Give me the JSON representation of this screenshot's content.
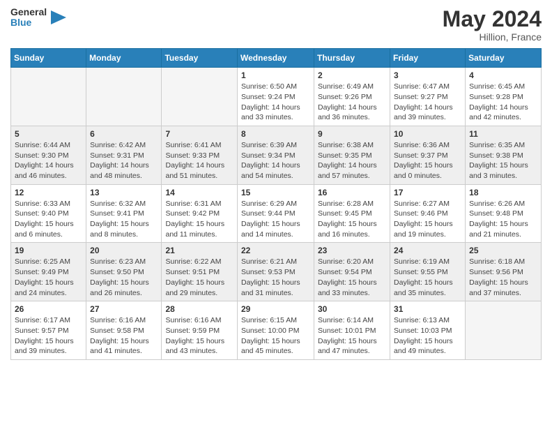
{
  "header": {
    "logo_general": "General",
    "logo_blue": "Blue",
    "month_year": "May 2024",
    "location": "Hillion, France"
  },
  "days_of_week": [
    "Sunday",
    "Monday",
    "Tuesday",
    "Wednesday",
    "Thursday",
    "Friday",
    "Saturday"
  ],
  "weeks": [
    [
      {
        "day": "",
        "info": ""
      },
      {
        "day": "",
        "info": ""
      },
      {
        "day": "",
        "info": ""
      },
      {
        "day": "1",
        "info": "Sunrise: 6:50 AM\nSunset: 9:24 PM\nDaylight: 14 hours\nand 33 minutes."
      },
      {
        "day": "2",
        "info": "Sunrise: 6:49 AM\nSunset: 9:26 PM\nDaylight: 14 hours\nand 36 minutes."
      },
      {
        "day": "3",
        "info": "Sunrise: 6:47 AM\nSunset: 9:27 PM\nDaylight: 14 hours\nand 39 minutes."
      },
      {
        "day": "4",
        "info": "Sunrise: 6:45 AM\nSunset: 9:28 PM\nDaylight: 14 hours\nand 42 minutes."
      }
    ],
    [
      {
        "day": "5",
        "info": "Sunrise: 6:44 AM\nSunset: 9:30 PM\nDaylight: 14 hours\nand 46 minutes."
      },
      {
        "day": "6",
        "info": "Sunrise: 6:42 AM\nSunset: 9:31 PM\nDaylight: 14 hours\nand 48 minutes."
      },
      {
        "day": "7",
        "info": "Sunrise: 6:41 AM\nSunset: 9:33 PM\nDaylight: 14 hours\nand 51 minutes."
      },
      {
        "day": "8",
        "info": "Sunrise: 6:39 AM\nSunset: 9:34 PM\nDaylight: 14 hours\nand 54 minutes."
      },
      {
        "day": "9",
        "info": "Sunrise: 6:38 AM\nSunset: 9:35 PM\nDaylight: 14 hours\nand 57 minutes."
      },
      {
        "day": "10",
        "info": "Sunrise: 6:36 AM\nSunset: 9:37 PM\nDaylight: 15 hours\nand 0 minutes."
      },
      {
        "day": "11",
        "info": "Sunrise: 6:35 AM\nSunset: 9:38 PM\nDaylight: 15 hours\nand 3 minutes."
      }
    ],
    [
      {
        "day": "12",
        "info": "Sunrise: 6:33 AM\nSunset: 9:40 PM\nDaylight: 15 hours\nand 6 minutes."
      },
      {
        "day": "13",
        "info": "Sunrise: 6:32 AM\nSunset: 9:41 PM\nDaylight: 15 hours\nand 8 minutes."
      },
      {
        "day": "14",
        "info": "Sunrise: 6:31 AM\nSunset: 9:42 PM\nDaylight: 15 hours\nand 11 minutes."
      },
      {
        "day": "15",
        "info": "Sunrise: 6:29 AM\nSunset: 9:44 PM\nDaylight: 15 hours\nand 14 minutes."
      },
      {
        "day": "16",
        "info": "Sunrise: 6:28 AM\nSunset: 9:45 PM\nDaylight: 15 hours\nand 16 minutes."
      },
      {
        "day": "17",
        "info": "Sunrise: 6:27 AM\nSunset: 9:46 PM\nDaylight: 15 hours\nand 19 minutes."
      },
      {
        "day": "18",
        "info": "Sunrise: 6:26 AM\nSunset: 9:48 PM\nDaylight: 15 hours\nand 21 minutes."
      }
    ],
    [
      {
        "day": "19",
        "info": "Sunrise: 6:25 AM\nSunset: 9:49 PM\nDaylight: 15 hours\nand 24 minutes."
      },
      {
        "day": "20",
        "info": "Sunrise: 6:23 AM\nSunset: 9:50 PM\nDaylight: 15 hours\nand 26 minutes."
      },
      {
        "day": "21",
        "info": "Sunrise: 6:22 AM\nSunset: 9:51 PM\nDaylight: 15 hours\nand 29 minutes."
      },
      {
        "day": "22",
        "info": "Sunrise: 6:21 AM\nSunset: 9:53 PM\nDaylight: 15 hours\nand 31 minutes."
      },
      {
        "day": "23",
        "info": "Sunrise: 6:20 AM\nSunset: 9:54 PM\nDaylight: 15 hours\nand 33 minutes."
      },
      {
        "day": "24",
        "info": "Sunrise: 6:19 AM\nSunset: 9:55 PM\nDaylight: 15 hours\nand 35 minutes."
      },
      {
        "day": "25",
        "info": "Sunrise: 6:18 AM\nSunset: 9:56 PM\nDaylight: 15 hours\nand 37 minutes."
      }
    ],
    [
      {
        "day": "26",
        "info": "Sunrise: 6:17 AM\nSunset: 9:57 PM\nDaylight: 15 hours\nand 39 minutes."
      },
      {
        "day": "27",
        "info": "Sunrise: 6:16 AM\nSunset: 9:58 PM\nDaylight: 15 hours\nand 41 minutes."
      },
      {
        "day": "28",
        "info": "Sunrise: 6:16 AM\nSunset: 9:59 PM\nDaylight: 15 hours\nand 43 minutes."
      },
      {
        "day": "29",
        "info": "Sunrise: 6:15 AM\nSunset: 10:00 PM\nDaylight: 15 hours\nand 45 minutes."
      },
      {
        "day": "30",
        "info": "Sunrise: 6:14 AM\nSunset: 10:01 PM\nDaylight: 15 hours\nand 47 minutes."
      },
      {
        "day": "31",
        "info": "Sunrise: 6:13 AM\nSunset: 10:03 PM\nDaylight: 15 hours\nand 49 minutes."
      },
      {
        "day": "",
        "info": ""
      }
    ]
  ]
}
